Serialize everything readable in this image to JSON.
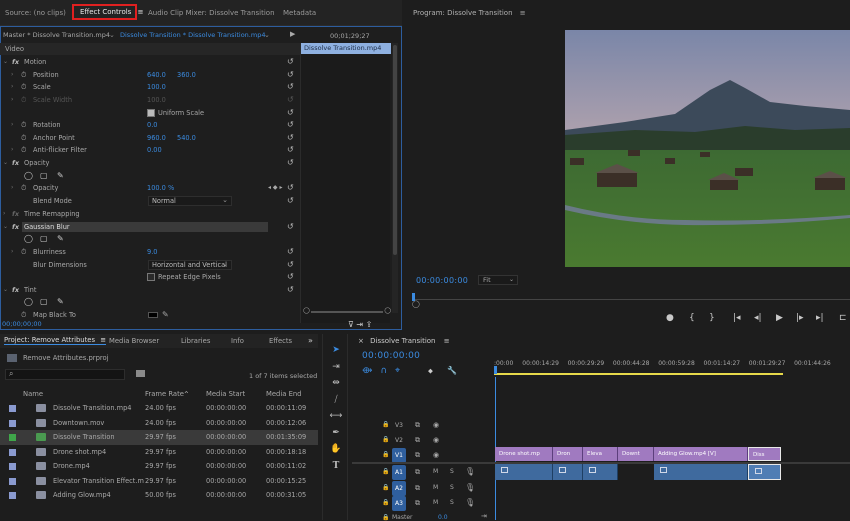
{
  "top_tabs": {
    "source": "Source: (no clips)",
    "effect_controls": "Effect Controls",
    "effect_controls_menu": "≡",
    "audio_mixer": "Audio Clip Mixer: Dissolve Transition",
    "metadata": "Metadata"
  },
  "effect_controls": {
    "master": "Master * Dissolve Transition.mp4",
    "clip": "Dissolve Transition * Dissolve Transition.mp4",
    "timecode": "00;01;29;27",
    "clip_bar": "Dissolve Transition.mp4",
    "video_label": "Video",
    "bottom_time": "00;00;00;00",
    "motion": {
      "label": "Motion",
      "position": "Position",
      "pos_x": "640.0",
      "pos_y": "360.0",
      "scale": "Scale",
      "scale_val": "100.0",
      "scale_width": "Scale Width",
      "scale_width_val": "100.0",
      "uniform": "Uniform Scale",
      "rotation": "Rotation",
      "rotation_val": "0.0",
      "anchor": "Anchor Point",
      "anchor_x": "960.0",
      "anchor_y": "540.0",
      "antiflicker": "Anti-flicker Filter",
      "antiflicker_val": "0.00"
    },
    "opacity": {
      "label": "Opacity",
      "opacity": "Opacity",
      "opacity_val": "100.0 %",
      "blend": "Blend Mode",
      "blend_val": "Normal"
    },
    "time_remap": "Time Remapping",
    "gaussian": {
      "label": "Gaussian Blur",
      "blurriness": "Blurriness",
      "blurriness_val": "9.0",
      "dims": "Blur Dimensions",
      "dims_val": "Horizontal and Vertical",
      "repeat": "Repeat Edge Pixels"
    },
    "tint": {
      "label": "Tint",
      "map_black": "Map Black To"
    }
  },
  "program": {
    "title": "Program: Dissolve Transition",
    "menu": "≡",
    "timecode": "00:00:00:00",
    "fit": "Fit"
  },
  "project": {
    "tabs": [
      "Project: Remove Attributes",
      "Media Browser",
      "Libraries",
      "Info",
      "Effects"
    ],
    "project_menu": "≡",
    "more": "»",
    "file": "Remove Attributes.prproj",
    "search_placeholder": "",
    "count": "1 of 7 items selected",
    "columns": [
      "Name",
      "Frame Rate",
      "Media Start",
      "Media End"
    ],
    "rows": [
      {
        "name": "Dissolve Transition.mp4",
        "fps": "24.00 fps",
        "start": "00:00:00:00",
        "end": "00:00:11:09",
        "color": "#8a9ad0"
      },
      {
        "name": "Downtown.mov",
        "fps": "24.00 fps",
        "start": "00:00:00:00",
        "end": "00:00:12:06",
        "color": "#8a9ad0"
      },
      {
        "name": "Dissolve Transition",
        "fps": "29.97 fps",
        "start": "00:00:00:00",
        "end": "00:01:35:09",
        "color": "#3fa64a"
      },
      {
        "name": "Drone shot.mp4",
        "fps": "29.97 fps",
        "start": "00:00:00:00",
        "end": "00:00:18:18",
        "color": "#8a9ad0"
      },
      {
        "name": "Drone.mp4",
        "fps": "29.97 fps",
        "start": "00:00:00:00",
        "end": "00:00:11:02",
        "color": "#8a9ad0"
      },
      {
        "name": "Elevator Transition Effect.m",
        "fps": "29.97 fps",
        "start": "00:00:00:00",
        "end": "00:00:15:25",
        "color": "#8a9ad0"
      },
      {
        "name": "Adding Glow.mp4",
        "fps": "50.00 fps",
        "start": "00:00:00:00",
        "end": "00:00:31:05",
        "color": "#8a9ad0"
      }
    ]
  },
  "timeline": {
    "title": "Dissolve Transition",
    "close": "×",
    "menu": "≡",
    "timecode": "00:00:00:00",
    "ruler": [
      ":00:00",
      "00:00:14:29",
      "00:00:29:29",
      "00:00:44:28",
      "00:00:59:28",
      "00:01:14:27",
      "00:01:29:27",
      "00:01:44:26"
    ],
    "tracks": [
      "V3",
      "V2",
      "V1",
      "A1",
      "A2",
      "A3"
    ],
    "master": "Master",
    "master_val": "0.0",
    "clips": [
      "Drone shot.mp",
      "Dron",
      "Eleva",
      "Downt",
      "Adding Glow.mp4 [V]",
      "Diss"
    ]
  }
}
